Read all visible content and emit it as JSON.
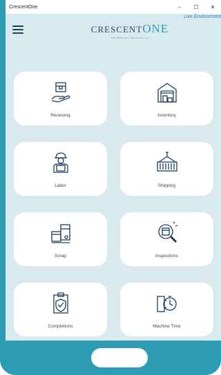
{
  "window": {
    "title": "CrescentOne",
    "minimize": "–",
    "maximize": "☐",
    "close": "✕"
  },
  "environment": "Live Environment",
  "logo": {
    "text_a": "CRESCENT",
    "text_b": "ONE",
    "tagline": "THE ORIGINAL CRESCENT ALI"
  },
  "tiles": [
    {
      "label": "Receiving",
      "icon": "receiving-icon"
    },
    {
      "label": "Inventory",
      "icon": "inventory-icon"
    },
    {
      "label": "Labor",
      "icon": "labor-icon"
    },
    {
      "label": "Shipping",
      "icon": "shipping-icon"
    },
    {
      "label": "Scrap",
      "icon": "scrap-icon"
    },
    {
      "label": "Inspections",
      "icon": "inspections-icon"
    },
    {
      "label": "Completions",
      "icon": "completions-icon"
    },
    {
      "label": "Machine Time",
      "icon": "machine-time-icon"
    }
  ],
  "colors": {
    "frame": "#2d9bb4",
    "background": "#d8eaee",
    "tile": "#ffffff",
    "icon_stroke": "#1a3e5c",
    "env_link": "#2b7fb3"
  }
}
